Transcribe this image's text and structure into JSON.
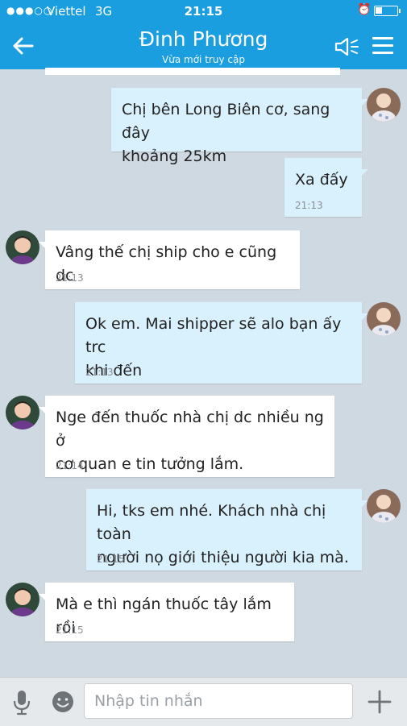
{
  "status_bar": {
    "signal": "●●●○○",
    "carrier": "Viettel",
    "network": "3G",
    "time": "21:15",
    "alarm_icon": "alarm-clock-icon",
    "battery_icon": "battery-icon"
  },
  "header": {
    "back_icon": "back-arrow-icon",
    "title": "Đinh Phương",
    "subtitle": "Vừa mới truy cập",
    "speaker_icon": "speaker-icon",
    "menu_icon": "hamburger-menu-icon",
    "background_color": "#1b9ee0"
  },
  "messages": [
    {
      "direction": "outgoing",
      "lines": [
        "Chị bên Long Biên cơ, sang đây",
        "khoảng 25km"
      ],
      "time": ""
    },
    {
      "direction": "outgoing",
      "lines": [
        "Xa đấy"
      ],
      "time": "21:13"
    },
    {
      "direction": "incoming",
      "lines": [
        "Vâng thế chị ship cho e cũng dc"
      ],
      "time": "21:13"
    },
    {
      "direction": "outgoing",
      "lines": [
        "Ok em. Mai shipper sẽ alo bạn ấy trc",
        "khi đến"
      ],
      "time": "21:13"
    },
    {
      "direction": "incoming",
      "lines": [
        "Nge đến thuốc nhà chị dc nhiều ng ở",
        "cơ quan e tin tưởng lắm."
      ],
      "time": "21:14"
    },
    {
      "direction": "outgoing",
      "lines": [
        "Hi, tks em nhé. Khách nhà chị toàn",
        "người nọ giới thiệu người kia mà."
      ],
      "time": "21:15"
    },
    {
      "direction": "incoming",
      "lines": [
        "Mà e thì ngán thuốc tây lắm rồi"
      ],
      "time": "21:15"
    }
  ],
  "input_bar": {
    "mic_icon": "microphone-icon",
    "emoji_icon": "emoji-icon",
    "placeholder": "Nhập tin nhắn",
    "plus_icon": "plus-icon"
  },
  "colors": {
    "outgoing_bubble": "#d9f0fd",
    "incoming_bubble": "#ffffff",
    "chat_background": "#cfd9e1"
  }
}
